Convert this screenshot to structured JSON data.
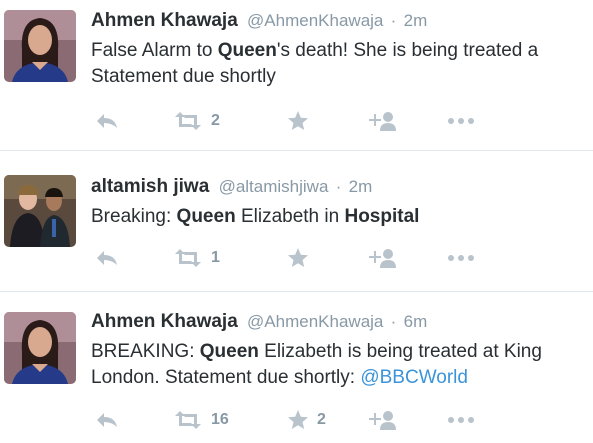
{
  "colors": {
    "text": "#292f33",
    "secondary": "#8899a6",
    "icon": "#b8c3cc",
    "link": "#3b94d9",
    "divider": "#e1e8ed"
  },
  "icons": {
    "reply": "reply-icon",
    "retweet": "retweet-icon",
    "favorite": "star-icon",
    "follow": "add-user-icon",
    "more": "more-dots-icon"
  },
  "tweets": [
    {
      "fullname": "Ahmen Khawaja",
      "username": "@AhmenKhawaja",
      "separator": "·",
      "time": "2m",
      "lines": [
        [
          {
            "t": "False Alarm to ",
            "b": false
          },
          {
            "t": "Queen",
            "b": true
          },
          {
            "t": "'s death! She is being treated a",
            "b": false
          }
        ],
        [
          {
            "t": "Statement due shortly",
            "b": false
          }
        ]
      ],
      "retweet_count": "2",
      "favorite_count": ""
    },
    {
      "fullname": "altamish jiwa",
      "username": "@altamishjiwa",
      "separator": "·",
      "time": "2m",
      "lines": [
        [
          {
            "t": "Breaking: ",
            "b": false
          },
          {
            "t": "Queen",
            "b": true
          },
          {
            "t": " Elizabeth in ",
            "b": false
          },
          {
            "t": "Hospital",
            "b": true
          }
        ]
      ],
      "retweet_count": "1",
      "favorite_count": ""
    },
    {
      "fullname": "Ahmen Khawaja",
      "username": "@AhmenKhawaja",
      "separator": "·",
      "time": "6m",
      "lines": [
        [
          {
            "t": "BREAKING: ",
            "b": false
          },
          {
            "t": "Queen",
            "b": true
          },
          {
            "t": " Elizabeth is being treated at King",
            "b": false
          }
        ],
        [
          {
            "t": "London. Statement due shortly: ",
            "b": false
          },
          {
            "t": "@BBCWorld",
            "b": false,
            "link": true
          }
        ]
      ],
      "retweet_count": "16",
      "favorite_count": "2"
    }
  ]
}
